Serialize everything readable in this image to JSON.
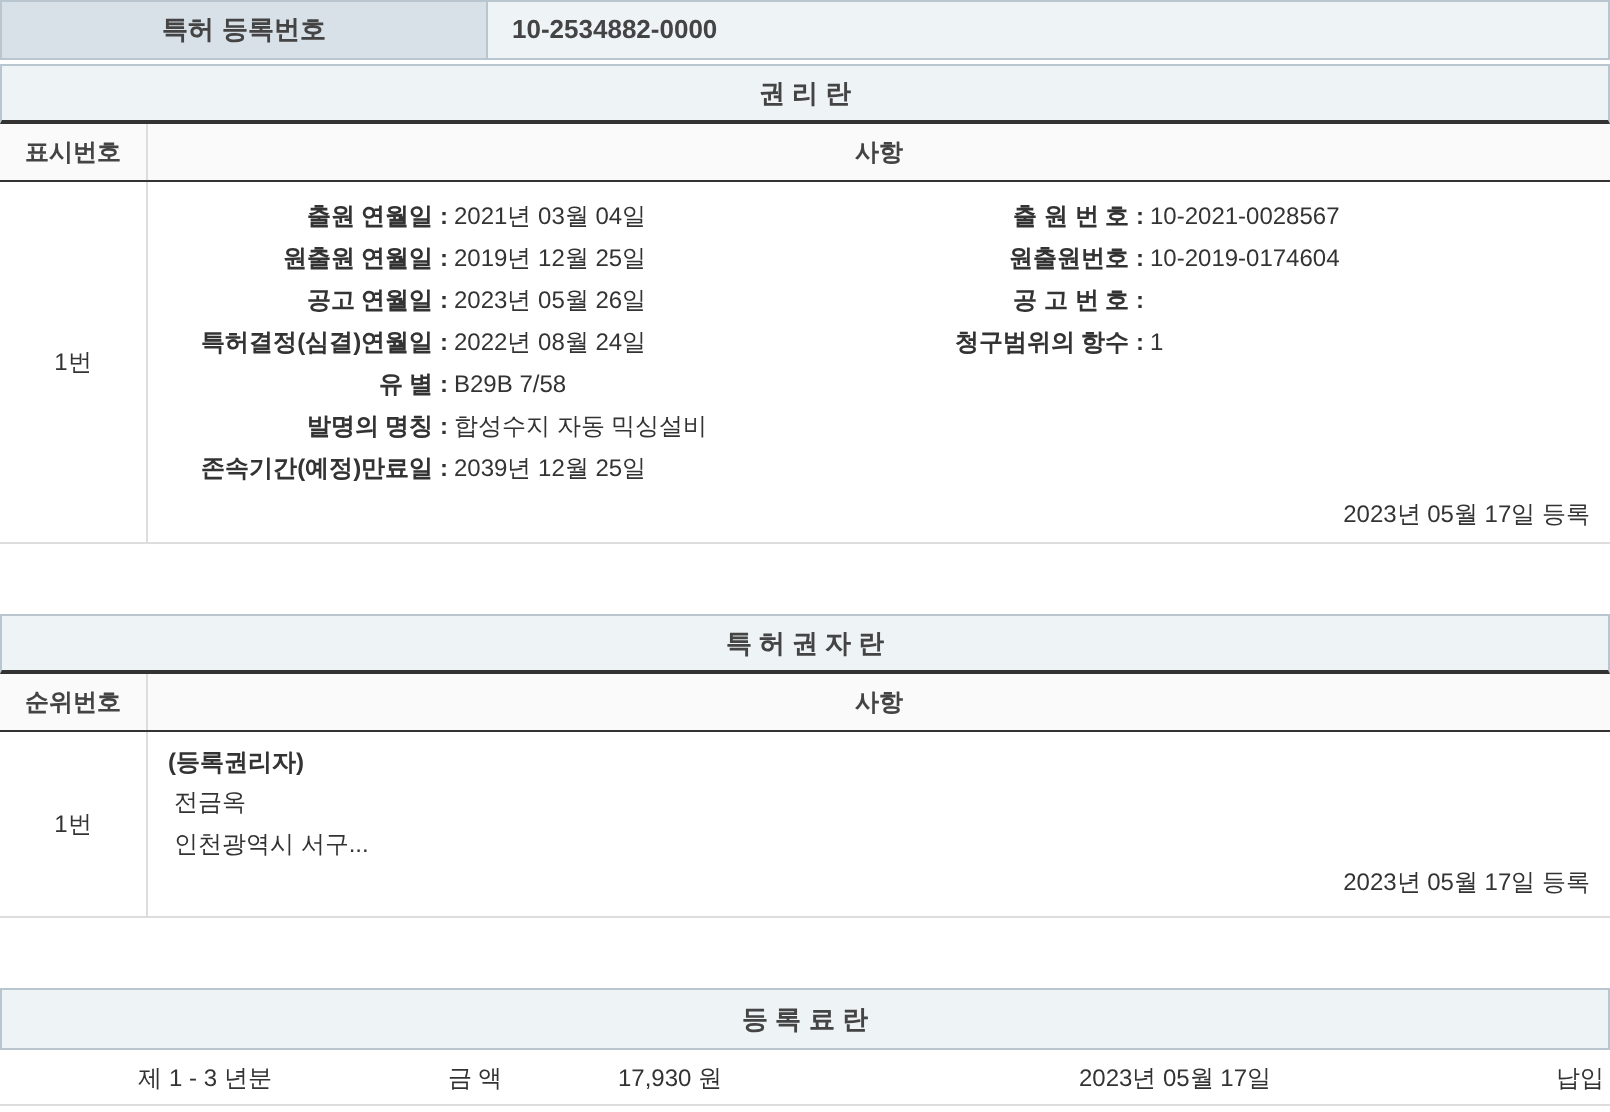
{
  "registration": {
    "label": "특허 등록번호",
    "value": "10-2534882-0000"
  },
  "rights": {
    "title": "권 리 란",
    "columns": [
      "표시번호",
      "사항"
    ],
    "rows": [
      {
        "number": "1번",
        "left_fields": [
          {
            "label": "출원 연월일 :",
            "value": "2021년 03월 04일"
          },
          {
            "label": "원출원 연월일 :",
            "value": "2019년 12월 25일"
          },
          {
            "label": "공고 연월일 :",
            "value": "2023년 05월 26일"
          },
          {
            "label": "특허결정(심결)연월일 :",
            "value": "2022년 08월 24일"
          },
          {
            "label": "유 별 :",
            "value": "B29B 7/58"
          },
          {
            "label": "발명의 명칭 :",
            "value": "합성수지 자동 믹싱설비"
          },
          {
            "label": "존속기간(예정)만료일 :",
            "value": "2039년 12월 25일"
          }
        ],
        "right_fields": [
          {
            "label": "출 원 번 호 :",
            "value": "10-2021-0028567"
          },
          {
            "label": "원출원번호 :",
            "value": "10-2019-0174604"
          },
          {
            "label": "공 고 번 호 :"
          },
          {
            "label": "청구범위의 항수 :",
            "value": "1"
          }
        ],
        "registered": "2023년 05월 17일 등록"
      }
    ]
  },
  "holders": {
    "title": "특 허 권 자 란",
    "columns": [
      "순위번호",
      "사항"
    ],
    "rows": [
      {
        "number": "1번",
        "role": "(등록권리자)",
        "lines": [
          "전금옥",
          "인천광역시 서구..."
        ],
        "registered": "2023년 05월 17일 등록"
      }
    ]
  },
  "fees": {
    "title": "등 록 료 란",
    "rows": [
      {
        "period": "제 1 - 3 년분",
        "amount_label": "금 액",
        "amount": "17,930 원",
        "date": "2023년 05월 17일",
        "status": "납입"
      }
    ]
  }
}
